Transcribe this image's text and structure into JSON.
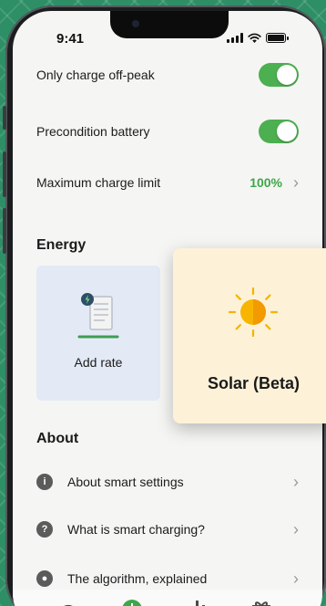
{
  "status_bar": {
    "time": "9:41"
  },
  "settings": {
    "off_peak": {
      "label": "Only charge off-peak",
      "enabled": true
    },
    "precondition": {
      "label": "Precondition battery",
      "enabled": true
    },
    "max_charge": {
      "label": "Maximum charge limit",
      "value": "100%"
    }
  },
  "energy": {
    "title": "Energy",
    "add_rate_label": "Add rate",
    "solar_label": "Solar (Beta)"
  },
  "about": {
    "title": "About",
    "items": [
      {
        "label": "About smart settings",
        "icon": "info-icon"
      },
      {
        "label": "What is smart charging?",
        "icon": "question-icon"
      },
      {
        "label": "The algorithm, explained",
        "icon": "people-icon"
      }
    ]
  },
  "tabbar": {
    "items": [
      {
        "icon": "gauge-icon"
      },
      {
        "icon": "smart-charge-icon",
        "active": true
      },
      {
        "icon": "bar-chart-icon"
      },
      {
        "icon": "gift-icon"
      }
    ]
  },
  "colors": {
    "toggle_on": "#4caf50",
    "value_green": "#3fa64a",
    "backdrop": "#2e8f66"
  }
}
